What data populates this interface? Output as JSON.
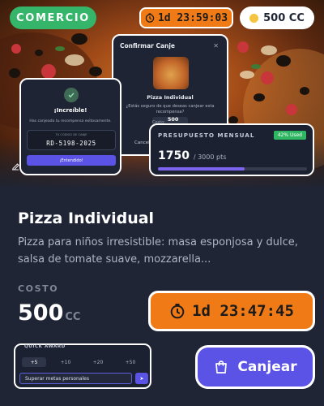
{
  "category_badge": "COMERCIO",
  "timer_top": "1d 23:59:03",
  "balance": "500 CC",
  "confirm_dialog": {
    "title": "Confirmar Canje",
    "item": "Pizza Individual",
    "question": "¿Estás seguro de que deseas canjear esta recompensa?",
    "cost_label": "Costo:",
    "cost_value": "500 CC",
    "cancel_label": "Cancel"
  },
  "success_dialog": {
    "title": "¡Increíble!",
    "subtitle": "Has canjeado tu recompensa exitosamente.",
    "code_label": "TU CÓDIGO DE CANJE",
    "code": "RD-5198-2025",
    "button": "¡Entendido!"
  },
  "budget": {
    "label": "PRESUPUESTO MENSUAL",
    "badge": "42% Used",
    "value": "1750",
    "max": "/ 3000 pts",
    "fraction_used": 0.58
  },
  "product": {
    "title": "Pizza Individual",
    "description": "Pizza para niños irresistible: masa esponjosa y dulce, salsa de tomate suave, mozzarella...",
    "cost_label": "COSTO",
    "cost_value": "500",
    "cost_unit": "CC"
  },
  "timer_big": "1d 23:47:45",
  "quick_award": {
    "label": "QUICK AWARD",
    "options": [
      "+5",
      "+10",
      "+20",
      "+50"
    ],
    "active_index": 0,
    "input_value": "Superar metas personales"
  },
  "redeem_button": "Canjear",
  "colors": {
    "accent": "#5b53e6",
    "timer": "#f07b16",
    "category": "#34b56a",
    "background": "#1f2535"
  },
  "icons": [
    "check-icon",
    "close-icon",
    "clock-icon",
    "coin-icon",
    "edit-icon",
    "bag-icon",
    "send-icon"
  ]
}
